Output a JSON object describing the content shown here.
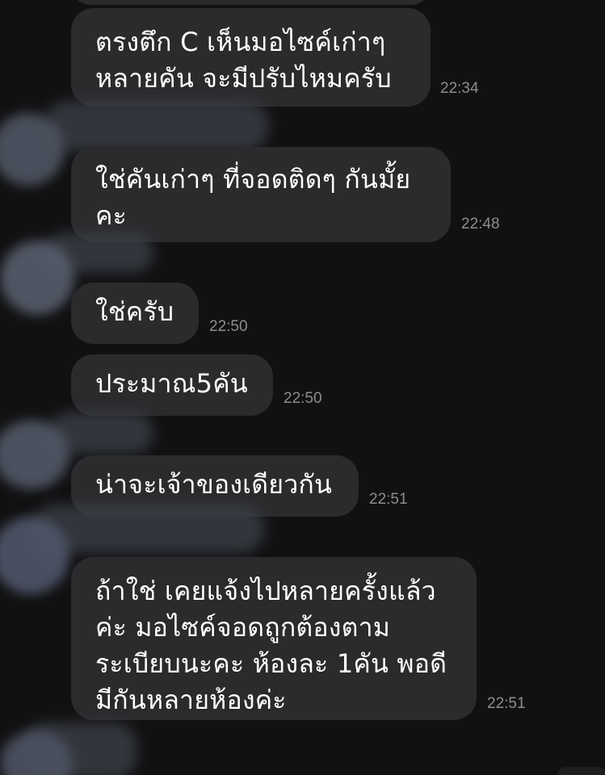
{
  "messages": [
    {
      "text": "ตรงตึก C เห็นมอไซค์เก่าๆ\nหลายคัน จะมีปรับไหมครับ",
      "time": "22:34"
    },
    {
      "text": "ใช่คันเก่าๆ ที่จอดติดๆ กันมั้ย\nคะ",
      "time": "22:48"
    },
    {
      "text": "ใช่ครับ",
      "time": "22:50"
    },
    {
      "text": "ประมาณ5คัน",
      "time": "22:50"
    },
    {
      "text": "น่าจะเจ้าของเดียวกัน",
      "time": "22:51"
    },
    {
      "text": "ถ้าใช่ เคยแจ้งไปหลายครั้งแล้ว\nค่ะ มอไซค์จอดถูกต้องตาม\nระเบียบนะคะ ห้องละ 1คัน พอดี\nมีกันหลายห้องค่ะ",
      "time": "22:51"
    }
  ],
  "colors": {
    "background": "#111112",
    "bubble": "#2b2b2d",
    "text": "#ffffff",
    "timestamp": "#8d8d92"
  }
}
